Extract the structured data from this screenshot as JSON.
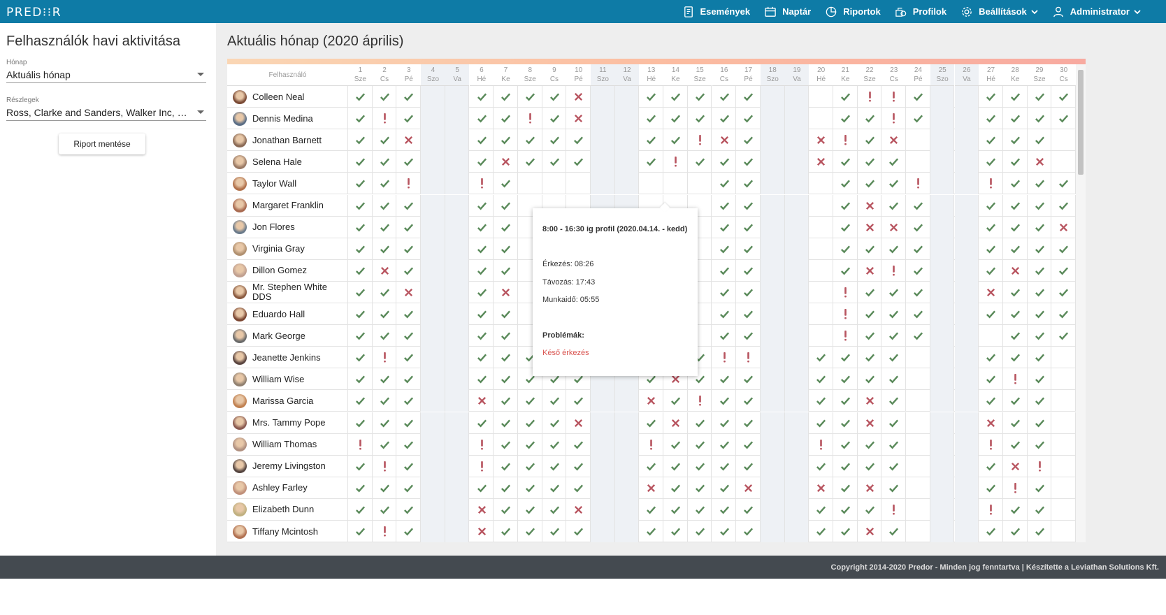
{
  "app": {
    "logo": "PRED⁝⁝R"
  },
  "nav": [
    {
      "label": "Események",
      "icon": "document-icon"
    },
    {
      "label": "Naptár",
      "icon": "calendar-icon"
    },
    {
      "label": "Riportok",
      "icon": "pie-chart-icon"
    },
    {
      "label": "Profilok",
      "icon": "profiles-icon"
    },
    {
      "label": "Beállítások",
      "icon": "gear-icon",
      "dropdown": true
    },
    {
      "label": "Administrator",
      "icon": "user-icon",
      "dropdown": true
    }
  ],
  "left": {
    "title": "Felhasználók havi aktivitása",
    "month_label": "Hónap",
    "month_value": "Aktuális hónap",
    "dept_label": "Részlegek",
    "dept_value": "Ross, Clarke and Sanders, Walker Inc, Morris and Sons",
    "save_button": "Riport mentése"
  },
  "main": {
    "title": "Aktuális hónap (2020 április)",
    "user_header": "Felhasználó",
    "days": [
      {
        "n": "1",
        "d": "Sze"
      },
      {
        "n": "2",
        "d": "Cs"
      },
      {
        "n": "3",
        "d": "Pé"
      },
      {
        "n": "4",
        "d": "Szo"
      },
      {
        "n": "5",
        "d": "Va"
      },
      {
        "n": "6",
        "d": "Hé"
      },
      {
        "n": "7",
        "d": "Ke"
      },
      {
        "n": "8",
        "d": "Sze"
      },
      {
        "n": "9",
        "d": "Cs"
      },
      {
        "n": "10",
        "d": "Pé"
      },
      {
        "n": "11",
        "d": "Szo"
      },
      {
        "n": "12",
        "d": "Va"
      },
      {
        "n": "13",
        "d": "Hé"
      },
      {
        "n": "14",
        "d": "Ke"
      },
      {
        "n": "15",
        "d": "Sze"
      },
      {
        "n": "16",
        "d": "Cs"
      },
      {
        "n": "17",
        "d": "Pé"
      },
      {
        "n": "18",
        "d": "Szo"
      },
      {
        "n": "19",
        "d": "Va"
      },
      {
        "n": "20",
        "d": "Hé"
      },
      {
        "n": "21",
        "d": "Ke"
      },
      {
        "n": "22",
        "d": "Sze"
      },
      {
        "n": "23",
        "d": "Cs"
      },
      {
        "n": "24",
        "d": "Pé"
      },
      {
        "n": "25",
        "d": "Szo"
      },
      {
        "n": "26",
        "d": "Va"
      },
      {
        "n": "27",
        "d": "Hé"
      },
      {
        "n": "28",
        "d": "Ke"
      },
      {
        "n": "29",
        "d": "Sze"
      },
      {
        "n": "30",
        "d": "Cs"
      }
    ],
    "users": [
      {
        "name": "Colleen Neal",
        "s": "ooo--oooox--oooooo--o!!o--oooo"
      },
      {
        "name": "Dennis Medina",
        "s": "o!o--oo!ox--oooooo--oo!o--oooo"
      },
      {
        "name": "Jonathan Barnett",
        "s": "oox--ooooo--oo!xo--x!ox--oooo"
      },
      {
        "name": "Selena Hale",
        "s": "ooo--oxooo--o!ooo--xooo--ooox"
      },
      {
        "name": "Taylor Wall",
        "s": "oo!--!o?????--?ooo--ooo!--!ooo"
      },
      {
        "name": "Margaret Franklin",
        "s": "ooo--oo?????--?ooo--oxoo--oooo"
      },
      {
        "name": "Jon Flores",
        "s": "ooo--oo?????--?ooo--oxxo--ooox"
      },
      {
        "name": "Virginia Gray",
        "s": "ooo--oo?????--?oox--oooo--oooo"
      },
      {
        "name": "Dillon Gomez",
        "s": "oxo--oo?????--?ooo--ox!o--oxoo"
      },
      {
        "name": "Mr. Stephen White DDS",
        "s": "oox--ox?????--?ooo--!ooo--xooo"
      },
      {
        "name": "Eduardo Hall",
        "s": "ooo--oo?????--?oo!--!ooo--oooo"
      },
      {
        "name": "Mark George",
        "s": "ooo--oo?????--?ooo--!oooo--oooo"
      },
      {
        "name": "Jeanette Jenkins",
        "s": "o!o--ooooo--ooo!!--oooo--oooo"
      },
      {
        "name": "William Wise",
        "s": "ooo--ooooo--oxooo--oooo--oo!o"
      },
      {
        "name": "Marissa Garcia",
        "s": "ooo--xoooo--xo!oo--ooxo--oooo"
      },
      {
        "name": "Mrs. Tammy Pope",
        "s": "ooo--oooox--oxooo--ooxo--oxoo"
      },
      {
        "name": "William Thomas",
        "s": "!oo--!oooo--!oooo--!ooo--o!oo"
      },
      {
        "name": "Jeremy Livingston",
        "s": "o!o--!oooo--ooooo--oooo--oox!"
      },
      {
        "name": "Ashley Farley",
        "s": "ooo--ooooo--xooox--xoxo--oo!o"
      },
      {
        "name": "Elizabeth Dunn",
        "s": "ooo--xooox--ooooo--ooo!--x!oo"
      },
      {
        "name": "Tiffany Mcintosh",
        "s": "o!o--xoooo--ooooo--ooxo--oooo"
      }
    ]
  },
  "tooltip": {
    "title": "8:00 - 16:30 ig profil (2020.04.14. - kedd)",
    "arrival": "Érkezés: 08:26",
    "departure": "Távozás: 17:43",
    "worktime": "Munkaidő: 05:55",
    "problems_label": "Problémák:",
    "problem": "Késő érkezés"
  },
  "footer": "Copyright 2014-2020 Predor - Minden jog fenntartva | Készítette a Leviathan Solutions Kft.",
  "colors": {
    "topbar": "#0e7ba6",
    "ok": "#5a8a5a",
    "error": "#b85560",
    "problem_text": "#d9534f",
    "footer": "#444a50"
  }
}
